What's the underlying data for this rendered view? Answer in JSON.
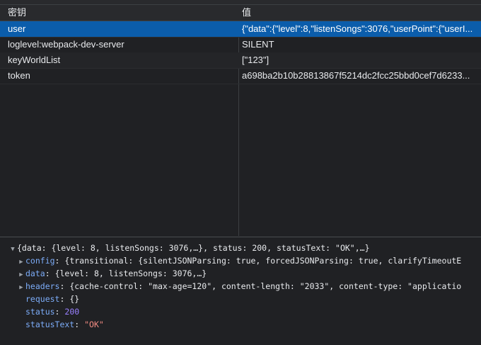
{
  "table": {
    "columns": {
      "key": "密钥",
      "value": "值"
    },
    "rows": [
      {
        "key": "user",
        "value": "{\"data\":{\"level\":8,\"listenSongs\":3076,\"userPoint\":{\"userI..."
      },
      {
        "key": "loglevel:webpack-dev-server",
        "value": "SILENT"
      },
      {
        "key": "keyWorldList",
        "value": "[\"123\"]"
      },
      {
        "key": "token",
        "value": "a698ba2b10b28813867f5214dc2fcc25bbd0cef7d6233..."
      }
    ]
  },
  "console": {
    "summary": "{data: {level: 8, listenSongs: 3076,…}, status: 200, statusText: \"OK\",…}",
    "config_key": "config",
    "config_val": "{transitional: {silentJSONParsing: true, forcedJSONParsing: true, clarifyTimeoutE",
    "data_key": "data",
    "data_val": "{level: 8, listenSongs: 3076,…}",
    "headers_key": "headers",
    "headers_val": "{cache-control: \"max-age=120\", content-length: \"2033\", content-type: \"applicatio",
    "request_key": "request",
    "request_val": "{}",
    "status_key": "status",
    "status_val": "200",
    "statusText_key": "statusText",
    "statusText_val": "\"OK\"",
    "sep": ": "
  },
  "icons": {
    "expanded": "triangle-down-icon",
    "collapsed": "triangle-right-icon"
  }
}
